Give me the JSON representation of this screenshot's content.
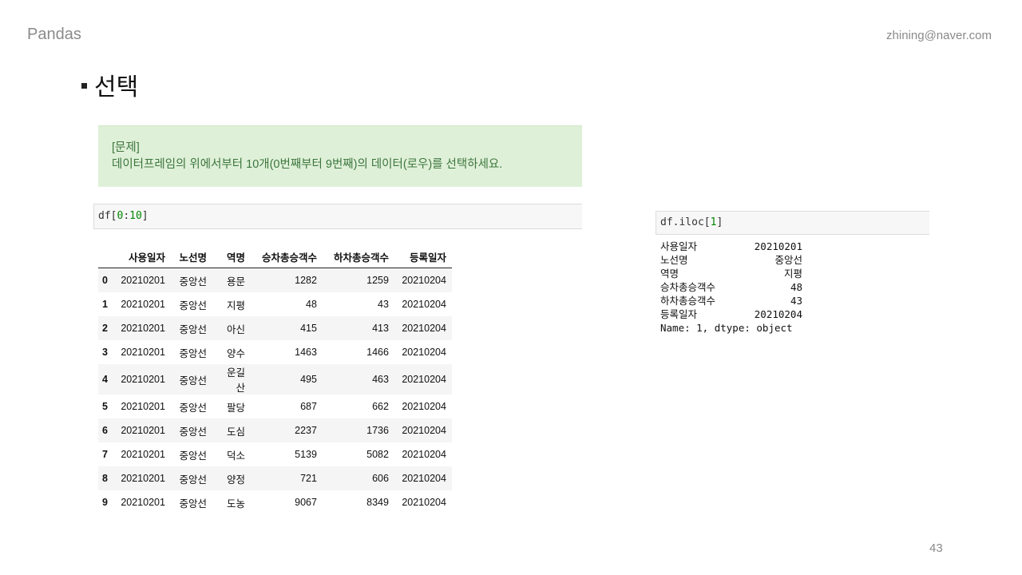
{
  "header": {
    "brand": "Pandas",
    "email": "zhining@naver.com"
  },
  "heading": {
    "title": "선택"
  },
  "problem": {
    "line1": "[문제]",
    "line2": "데이터프레임의 위에서부터 10개(0번째부터 9번째)의 데이터(로우)를 선택하세요."
  },
  "code_left": {
    "prefix": "df[",
    "start": "0",
    "sep": ":",
    "end": "10",
    "suffix": "]"
  },
  "code_right": {
    "prefix": "df.iloc[",
    "index": "1",
    "suffix": "]"
  },
  "table": {
    "columns": [
      "사용일자",
      "노선명",
      "역명",
      "승차총승객수",
      "하차총승객수",
      "등록일자"
    ],
    "rows": [
      {
        "idx": "0",
        "cells": [
          "20210201",
          "중앙선",
          "용문",
          "1282",
          "1259",
          "20210204"
        ]
      },
      {
        "idx": "1",
        "cells": [
          "20210201",
          "중앙선",
          "지평",
          "48",
          "43",
          "20210204"
        ]
      },
      {
        "idx": "2",
        "cells": [
          "20210201",
          "중앙선",
          "아신",
          "415",
          "413",
          "20210204"
        ]
      },
      {
        "idx": "3",
        "cells": [
          "20210201",
          "중앙선",
          "양수",
          "1463",
          "1466",
          "20210204"
        ]
      },
      {
        "idx": "4",
        "cells": [
          "20210201",
          "중앙선",
          "운길산",
          "495",
          "463",
          "20210204"
        ]
      },
      {
        "idx": "5",
        "cells": [
          "20210201",
          "중앙선",
          "팔당",
          "687",
          "662",
          "20210204"
        ]
      },
      {
        "idx": "6",
        "cells": [
          "20210201",
          "중앙선",
          "도심",
          "2237",
          "1736",
          "20210204"
        ]
      },
      {
        "idx": "7",
        "cells": [
          "20210201",
          "중앙선",
          "덕소",
          "5139",
          "5082",
          "20210204"
        ]
      },
      {
        "idx": "8",
        "cells": [
          "20210201",
          "중앙선",
          "양정",
          "721",
          "606",
          "20210204"
        ]
      },
      {
        "idx": "9",
        "cells": [
          "20210201",
          "중앙선",
          "도농",
          "9067",
          "8349",
          "20210204"
        ]
      }
    ]
  },
  "series": {
    "rows": [
      {
        "key": "사용일자",
        "value": "20210201"
      },
      {
        "key": "노선명",
        "value": "중앙선"
      },
      {
        "key": "역명",
        "value": "지평"
      },
      {
        "key": "승차총승객수",
        "value": "48"
      },
      {
        "key": "하차총승객수",
        "value": "43"
      },
      {
        "key": "등록일자",
        "value": "20210204"
      }
    ],
    "footer": "Name: 1, dtype: object"
  },
  "page_number": "43"
}
